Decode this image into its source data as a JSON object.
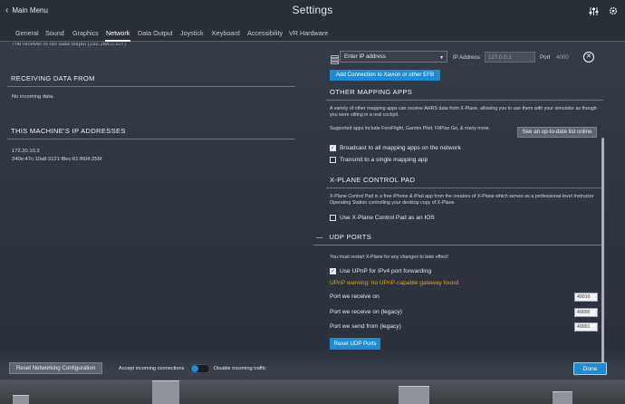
{
  "header": {
    "back_label": "Main Menu",
    "title": "Settings",
    "icons": [
      "sliders-icon",
      "gear-icon"
    ]
  },
  "tabs": [
    {
      "label": "General"
    },
    {
      "label": "Sound"
    },
    {
      "label": "Graphics"
    },
    {
      "label": "Network"
    },
    {
      "label": "Data Output"
    },
    {
      "label": "Joystick"
    },
    {
      "label": "Keyboard"
    },
    {
      "label": "Accessibility"
    },
    {
      "label": "VR Hardware"
    }
  ],
  "active_tab": "Network",
  "left": {
    "cutoff_text": "The receiver of our data output (192.168.0.107)",
    "receiving": {
      "heading": "RECEIVING DATA FROM",
      "text": "No incoming data."
    },
    "ip": {
      "heading": "THIS MACHINE'S IP ADDRESSES",
      "addresses": [
        "172.20.10.3",
        "240e:47c:10a8:3121:f8ec:61:f604:256f"
      ]
    }
  },
  "right": {
    "connection": {
      "ip_dropdown_placeholder": "Enter IP address",
      "ip_address_label": "IP Address",
      "ip_address_value": "127.0.0.1",
      "port_label": "Port",
      "port_value": "4000",
      "add_button": "Add Connection to Xavion or other EFB"
    },
    "mapping": {
      "heading": "OTHER MAPPING APPS",
      "description": "A variety of other mapping apps can receive AHRS data from X-Plane, allowing you to use them with your simulator as though you were sitting in a real cockpit.",
      "supported": "Supported apps include ForeFlight, Garmin Pilot, FltPlan Go, & many more.",
      "list_button": "See an up-to-date list online",
      "broadcast_label": "Broadcast to all mapping apps on the network",
      "broadcast_checked": true,
      "single_label": "Transmit to a single mapping app",
      "single_checked": false
    },
    "control_pad": {
      "heading": "X-PLANE CONTROL PAD",
      "description": "X-Plane Control Pad is a free iPhone & iPad app from the creators of X-Plane which serves as a professional-level Instructor Operating Station controlling your desktop copy of X-Plane.",
      "ios_label": "Use X-Plane Control Pad as an IOS",
      "ios_checked": false
    },
    "udp": {
      "heading": "UDP PORTS",
      "collapse_glyph": "—",
      "restart_note": "You must restart X-Plane for any changes to take effect!",
      "upnp_label": "Use UPnP for IPv4 port forwarding",
      "upnp_checked": true,
      "warning": "UPnP warning: no UPnP-capable gateway found",
      "ports": [
        {
          "label": "Port we receive on",
          "value": "49010"
        },
        {
          "label": "Port we receive on (legacy)",
          "value": "49000"
        },
        {
          "label": "Port we send from (legacy)",
          "value": "49001"
        }
      ],
      "reset_button": "Reset UDP Ports"
    }
  },
  "footer": {
    "reset_networking": "Reset Networking Configuration",
    "accept_label": "Accept incoming connections",
    "disable_label": "Disable incoming traffic",
    "done": "Done"
  },
  "colors": {
    "accent": "#1f8bd0",
    "warning": "#e6a118"
  }
}
